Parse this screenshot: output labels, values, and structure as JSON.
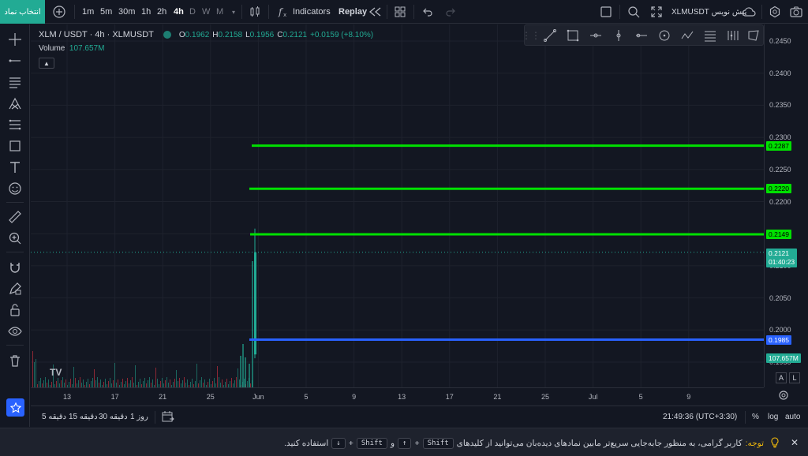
{
  "toolbar": {
    "symbol_button": "انتخاب نماد",
    "intervals": [
      "1m",
      "5m",
      "30m",
      "1h",
      "2h",
      "4h",
      "D",
      "W",
      "M"
    ],
    "active_interval": "4h",
    "indicators_label": "Indicators",
    "replay_label": "Replay",
    "symbol_right": "XLMUSDT",
    "preview_label": "پیش نویس"
  },
  "legend": {
    "symbol": "XLM / USDT · 4h · XLMUSDT",
    "o_label": "O",
    "o": "0.1962",
    "h_label": "H",
    "h": "0.2158",
    "l_label": "L",
    "l": "0.1956",
    "c_label": "C",
    "c": "0.2121",
    "change": "+0.0159 (+8.10%)",
    "volume_label": "Volume",
    "volume": "107.657M"
  },
  "price_scale": {
    "ticks": [
      "0.2450",
      "0.2400",
      "0.2350",
      "0.2300",
      "0.2250",
      "0.2200",
      "0.2150",
      "0.2100",
      "0.2050",
      "0.2000",
      "0.1950"
    ],
    "lines": [
      {
        "value": "0.2287",
        "color": "#00e000"
      },
      {
        "value": "0.2220",
        "color": "#00e000"
      },
      {
        "value": "0.2149",
        "color": "#00e000"
      },
      {
        "value": "0.1985",
        "color": "#2962ff"
      }
    ],
    "current_price": "0.2121",
    "countdown": "01:40:23",
    "volume_label": "107.657M",
    "auto_a": "A",
    "auto_l": "L"
  },
  "time_scale": {
    "labels": [
      "13",
      "17",
      "21",
      "25",
      "Jun",
      "5",
      "9",
      "13",
      "17",
      "21",
      "25",
      "Jul",
      "5",
      "9"
    ]
  },
  "bottom": {
    "ranges": [
      "5 دقیقه",
      "15 دقیقه",
      "30 دقیقه",
      "1 روز"
    ],
    "clock": "21:49:36 (UTC+3:30)",
    "percent": "%",
    "log": "log",
    "auto": "auto"
  },
  "notice": {
    "prefix": "توجه:",
    "text1": "کاربر گرامی، به منظور جابه‌جایی سریع‌تر مابین نمادهای دیده‌بان می‌توانید از کلیدهای",
    "key_shift": "Shift",
    "plus": "+",
    "key_up": "↑",
    "and": "و",
    "key_down": "↓",
    "text2": "استفاده کنید."
  },
  "colors": {
    "accent": "#22ab94",
    "bull": "#22ab94",
    "bear": "#f23645",
    "line_green": "#00e000",
    "line_blue": "#2962ff",
    "fav": "#2962ff"
  }
}
